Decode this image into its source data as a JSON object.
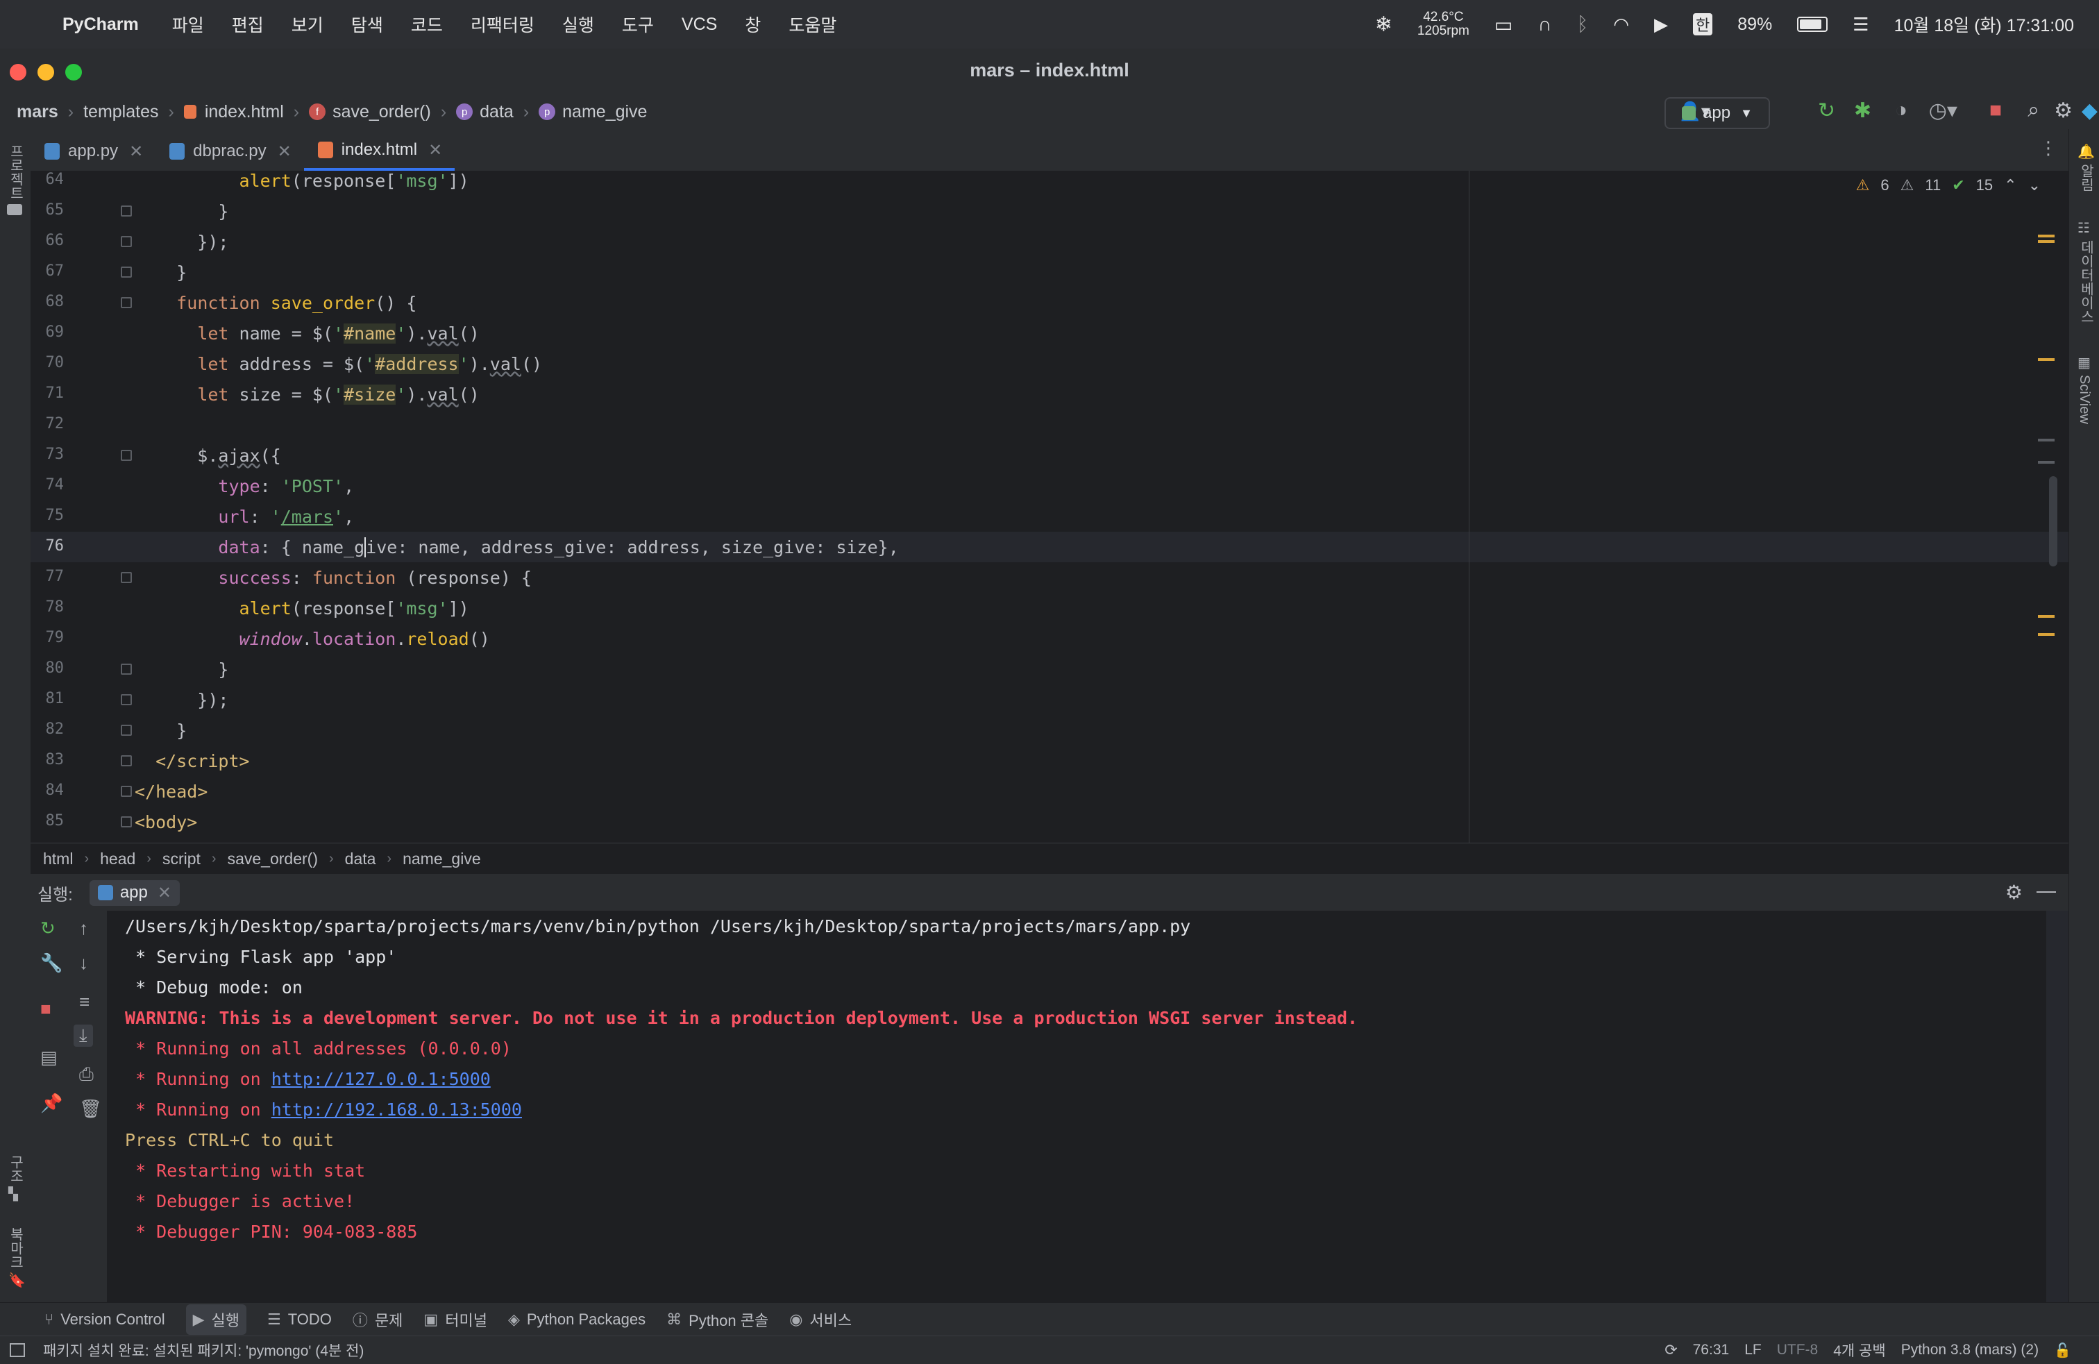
{
  "menubar": {
    "app_name": "PyCharm",
    "items": [
      "파일",
      "편집",
      "보기",
      "탐색",
      "코드",
      "리팩터링",
      "실행",
      "도구",
      "VCS",
      "창",
      "도움말"
    ],
    "temp": "42.6°C",
    "rpm": "1205rpm",
    "input_lang": "한",
    "battery": "89%",
    "datetime": "10월 18일 (화)  17:31:00"
  },
  "window": {
    "title": "mars – index.html"
  },
  "navbar": {
    "crumbs": [
      "mars",
      "templates",
      "index.html",
      "save_order()",
      "data",
      "name_give"
    ],
    "run_config": "app"
  },
  "tabs": [
    {
      "label": "app.py",
      "color": "#4a88c7"
    },
    {
      "label": "dbprac.py",
      "color": "#4a88c7"
    },
    {
      "label": "index.html",
      "color": "#e8774a"
    }
  ],
  "sidebar_left": {
    "project": "프로젝트",
    "structure": "구조",
    "bookmarks": "북마크"
  },
  "sidebar_right": {
    "notifications": "알림",
    "database": "데이터베이스",
    "sciview": "SciView"
  },
  "inspections": {
    "warnings": "6",
    "weak": "11",
    "ok": "15"
  },
  "editor": {
    "line_numbers": [
      "64",
      "65",
      "66",
      "67",
      "68",
      "69",
      "70",
      "71",
      "72",
      "73",
      "74",
      "75",
      "76",
      "77",
      "78",
      "79",
      "80",
      "81",
      "82",
      "83",
      "84",
      "85"
    ],
    "current_line": "76"
  },
  "editor_breadcrumb": [
    "html",
    "head",
    "script",
    "save_order()",
    "data",
    "name_give"
  ],
  "run_panel": {
    "label": "실행:",
    "tab": "app",
    "lines": [
      {
        "text": "/Users/kjh/Desktop/sparta/projects/mars/venv/bin/python /Users/kjh/Desktop/sparta/projects/mars/app.py",
        "kind": "plain"
      },
      {
        "text": " * Serving Flask app 'app'",
        "kind": "plain"
      },
      {
        "text": " * Debug mode: on",
        "kind": "plain"
      },
      {
        "text": "WARNING: This is a development server. Do not use it in a production deployment. Use a production WSGI server instead.",
        "kind": "warn"
      },
      {
        "text": " * Running on all addresses (0.0.0.0)",
        "kind": "err"
      },
      {
        "text": " * Running on ",
        "kind": "err",
        "link": "http://127.0.0.1:5000"
      },
      {
        "text": " * Running on ",
        "kind": "err",
        "link": "http://192.168.0.13:5000"
      },
      {
        "text": "Press CTRL+C to quit",
        "kind": "yel"
      },
      {
        "text": " * Restarting with stat",
        "kind": "err"
      },
      {
        "text": " * Debugger is active!",
        "kind": "err"
      },
      {
        "text": " * Debugger PIN: 904-083-885",
        "kind": "err"
      }
    ]
  },
  "bottom_toolbar": [
    "Version Control",
    "실행",
    "TODO",
    "문제",
    "터미널",
    "Python Packages",
    "Python 콘솔",
    "서비스"
  ],
  "status": {
    "message": "패키지 설치 완료: 설치된 패키지: 'pymongo' (4분 전)",
    "position": "76:31",
    "line_sep": "LF",
    "encoding": "UTF-8",
    "indent": "4개 공백",
    "interpreter": "Python 3.8 (mars) (2)"
  }
}
